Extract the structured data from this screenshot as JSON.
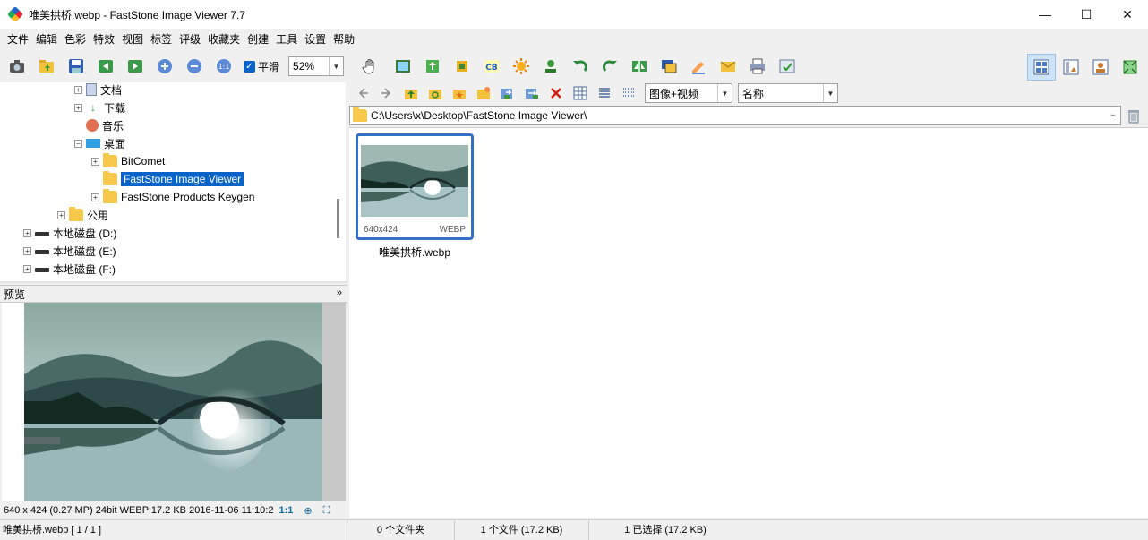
{
  "window": {
    "title": "唯美拱桥.webp  -  FastStone Image Viewer 7.7",
    "minimize": "—",
    "maximize": "☐",
    "close": "✕"
  },
  "menu": [
    "文件",
    "编辑",
    "色彩",
    "特效",
    "视图",
    "标签",
    "评级",
    "收藏夹",
    "创建",
    "工具",
    "设置",
    "帮助"
  ],
  "toolbar": {
    "smooth_label": "平滑",
    "zoom_value": "52%"
  },
  "tree": {
    "items": [
      {
        "label": "文档",
        "icon": "document-icon"
      },
      {
        "label": "下载",
        "icon": "download-icon"
      },
      {
        "label": "音乐",
        "icon": "music-icon"
      },
      {
        "label": "桌面",
        "icon": "desktop-icon"
      },
      {
        "label": "BitComet",
        "icon": "folder-icon"
      },
      {
        "label": "FastStone Image Viewer",
        "icon": "folder-icon",
        "selected": true
      },
      {
        "label": "FastStone Products Keygen",
        "icon": "folder-icon"
      },
      {
        "label": "公用",
        "icon": "folder-icon"
      },
      {
        "label": "本地磁盘 (D:)",
        "icon": "drive-icon"
      },
      {
        "label": "本地磁盘 (E:)",
        "icon": "drive-icon"
      },
      {
        "label": "本地磁盘 (F:)",
        "icon": "drive-icon"
      }
    ]
  },
  "preview": {
    "header": "预览",
    "info": "640 x 424 (0.27 MP)   24bit   WEBP    17.2 KB   2016-11-06 11:10:2",
    "ratio_label": "1:1"
  },
  "browser": {
    "filter_value": "图像+视频",
    "sort_value": "名称",
    "path": "C:\\Users\\x\\Desktop\\FastStone Image Viewer\\",
    "files": [
      {
        "name": "唯美拱桥.webp",
        "dims": "640x424",
        "type": "WEBP"
      }
    ]
  },
  "status": {
    "file": "唯美拱桥.webp [ 1 / 1 ]",
    "folders": "0 个文件夹",
    "files": "1 个文件 (17.2 KB)",
    "selected": "1 已选择 (17.2 KB)"
  },
  "colors": {
    "accent": "#0a64c8",
    "thumb_border": "#3470c8"
  }
}
